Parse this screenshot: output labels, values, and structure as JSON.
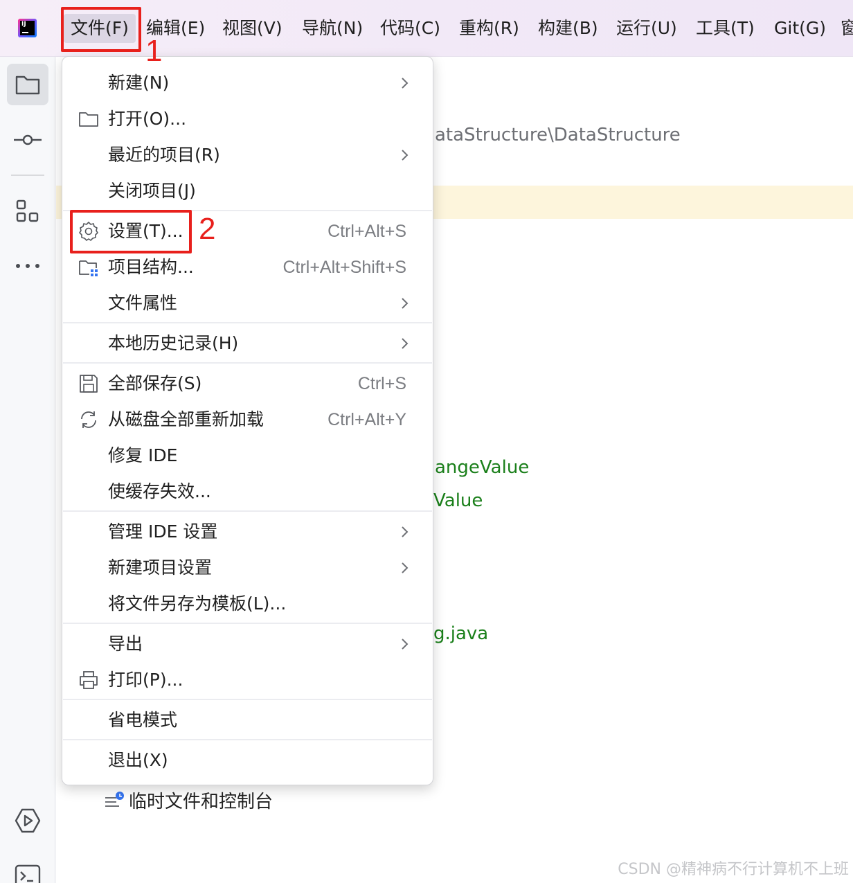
{
  "menubar": {
    "logo_text": "IJ",
    "items": [
      {
        "label": "文件(F)"
      },
      {
        "label": "编辑(E)"
      },
      {
        "label": "视图(V)"
      },
      {
        "label": "导航(N)"
      },
      {
        "label": "代码(C)"
      },
      {
        "label": "重构(R)"
      },
      {
        "label": "构建(B)"
      },
      {
        "label": "运行(U)"
      },
      {
        "label": "工具(T)"
      },
      {
        "label": "Git(G)"
      },
      {
        "label": "窗"
      }
    ]
  },
  "annotations": {
    "step1": "1",
    "step2": "2"
  },
  "file_menu": {
    "items": [
      {
        "label": "新建(N)",
        "shortcut": "",
        "submenu": true,
        "icon": ""
      },
      {
        "label": "打开(O)...",
        "shortcut": "",
        "submenu": false,
        "icon": "folder-icon"
      },
      {
        "label": "最近的项目(R)",
        "shortcut": "",
        "submenu": true,
        "icon": ""
      },
      {
        "label": "关闭项目(J)",
        "shortcut": "",
        "submenu": false,
        "icon": ""
      },
      {
        "label": "设置(T)...",
        "shortcut": "Ctrl+Alt+S",
        "submenu": false,
        "icon": "gear-icon"
      },
      {
        "label": "项目结构...",
        "shortcut": "Ctrl+Alt+Shift+S",
        "submenu": false,
        "icon": "project-structure-icon"
      },
      {
        "label": "文件属性",
        "shortcut": "",
        "submenu": true,
        "icon": ""
      },
      {
        "label": "本地历史记录(H)",
        "shortcut": "",
        "submenu": true,
        "icon": ""
      },
      {
        "label": "全部保存(S)",
        "shortcut": "Ctrl+S",
        "submenu": false,
        "icon": "save-icon"
      },
      {
        "label": "从磁盘全部重新加载",
        "shortcut": "Ctrl+Alt+Y",
        "submenu": false,
        "icon": "reload-icon"
      },
      {
        "label": "修复 IDE",
        "shortcut": "",
        "submenu": false,
        "icon": ""
      },
      {
        "label": "使缓存失效...",
        "shortcut": "",
        "submenu": false,
        "icon": ""
      },
      {
        "label": "管理 IDE 设置",
        "shortcut": "",
        "submenu": true,
        "icon": ""
      },
      {
        "label": "新建项目设置",
        "shortcut": "",
        "submenu": true,
        "icon": ""
      },
      {
        "label": "将文件另存为模板(L)...",
        "shortcut": "",
        "submenu": false,
        "icon": ""
      },
      {
        "label": "导出",
        "shortcut": "",
        "submenu": true,
        "icon": ""
      },
      {
        "label": "打印(P)...",
        "shortcut": "",
        "submenu": false,
        "icon": "print-icon"
      },
      {
        "label": "省电模式",
        "shortcut": "",
        "submenu": false,
        "icon": ""
      },
      {
        "label": "退出(X)",
        "shortcut": "",
        "submenu": false,
        "icon": ""
      }
    ]
  },
  "background": {
    "path_text": "ataStructure\\DataStructure",
    "code_line1": "angeValue",
    "code_line2": "Value",
    "code_line3": "g.java",
    "scratch_label": "临时文件和控制台"
  },
  "watermark": "CSDN @精神病不行计算机不上班"
}
